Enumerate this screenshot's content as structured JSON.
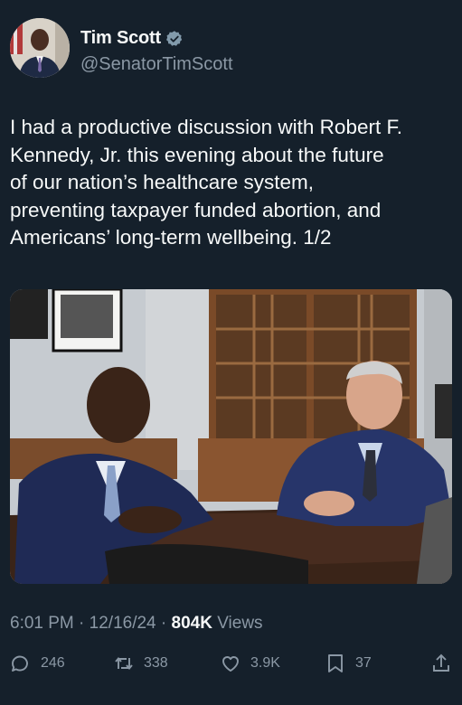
{
  "author": {
    "display_name": "Tim Scott",
    "handle": "@SenatorTimScott",
    "verified": true,
    "avatar_icon": "profile-photo"
  },
  "post": {
    "text": "I had a productive discussion with Robert F.\nKennedy, Jr. this evening about the future\nof our nation’s healthcare system,\npreventing taxpayer funded abortion, and\nAmericans’ long-term wellbeing. 1/2",
    "photo_icon": "meeting-photo"
  },
  "meta": {
    "time": "6:01 PM",
    "separator": " · ",
    "date": "12/16/24",
    "views_count": "804K",
    "views_label": " Views"
  },
  "actions": {
    "replies": "246",
    "reposts": "338",
    "likes": "3.9K",
    "bookmarks": "37"
  },
  "colors": {
    "background": "#15202b",
    "text": "#f7f9f9",
    "secondary": "#8b98a5",
    "verified_badge": "#829aab"
  }
}
